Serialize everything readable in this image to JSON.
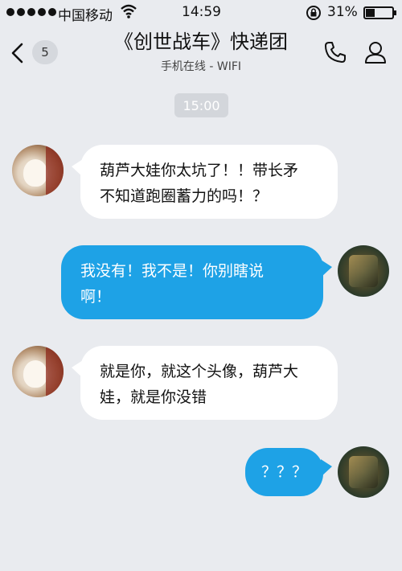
{
  "status_bar": {
    "carrier": "中国移动",
    "time": "14:59",
    "battery_percent": "31%",
    "battery_level": 0.31,
    "icons": [
      "signal-dots-icon",
      "wifi-icon",
      "orientation-lock-icon",
      "battery-icon"
    ]
  },
  "nav": {
    "back_icon": "chevron-left-icon",
    "unread_count": "5",
    "title": "《创世战车》快递团",
    "subtitle": "手机在线 - WIFI",
    "call_icon": "phone-icon",
    "profile_icon": "person-icon"
  },
  "chat": {
    "timestamp": "15:00",
    "messages": [
      {
        "side": "left",
        "avatar": "cat-avatar",
        "text_lines": [
          "葫芦大娃你太坑了！！带长矛",
          "不知道跑圈蓄力的吗！？"
        ]
      },
      {
        "side": "right",
        "avatar": "game-avatar",
        "text_lines": [
          "我没有！我不是！你别瞎说",
          "啊！"
        ]
      },
      {
        "side": "left",
        "avatar": "cat-avatar",
        "text_lines": [
          "就是你，就这个头像，葫芦大",
          "娃，就是你没错"
        ]
      },
      {
        "side": "right",
        "avatar": "game-avatar",
        "text_lines": [
          "？？？"
        ]
      }
    ]
  },
  "colors": {
    "background": "#e9ebef",
    "outgoing_bubble": "#1ea2e6",
    "incoming_bubble": "#ffffff"
  }
}
